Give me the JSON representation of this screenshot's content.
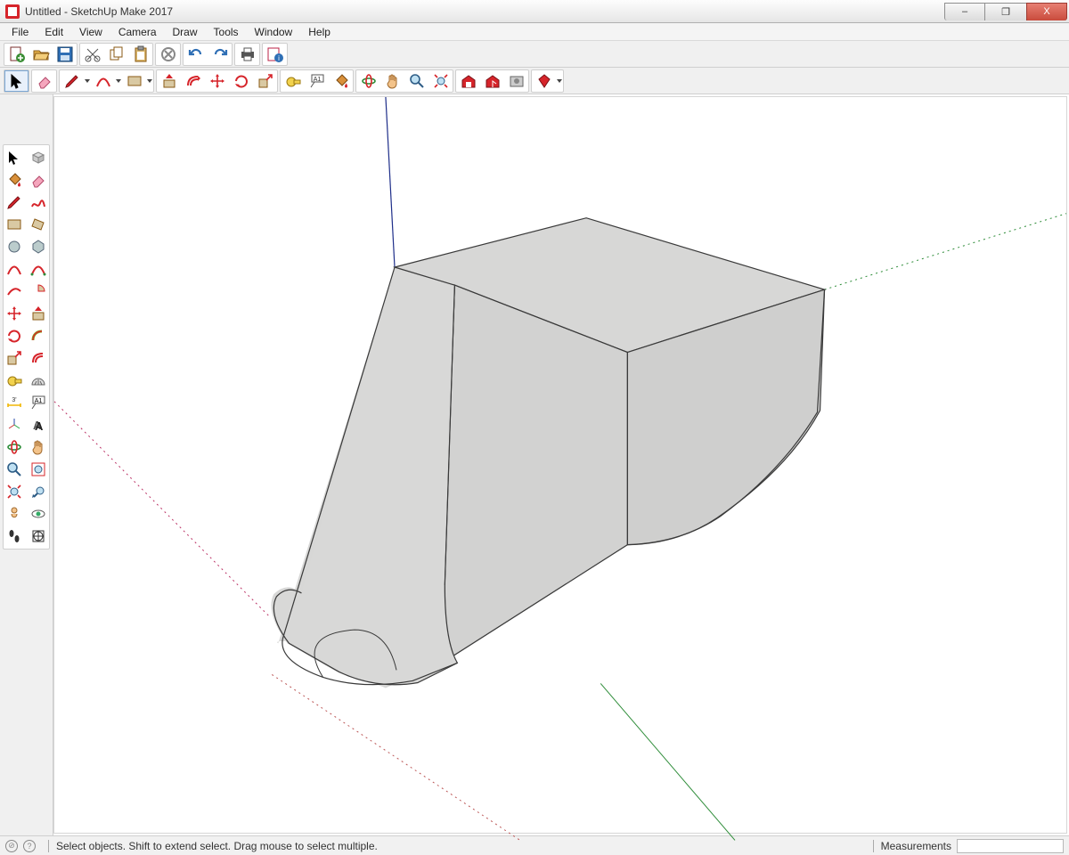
{
  "window": {
    "title": "Untitled - SketchUp Make 2017"
  },
  "menu": {
    "items": [
      "File",
      "Edit",
      "View",
      "Camera",
      "Draw",
      "Tools",
      "Window",
      "Help"
    ]
  },
  "toolbar1": {
    "new": "new-file",
    "open": "open-file",
    "save": "save-file",
    "cut": "cut",
    "copy": "copy",
    "paste": "paste",
    "erase": "delete",
    "undo": "undo",
    "redo": "redo",
    "print": "print",
    "model-info": "model-info"
  },
  "toolbar2": {
    "select": "select",
    "eraser": "eraser",
    "line": "line",
    "arc": "arc",
    "shape": "rectangle",
    "pushpull": "push-pull",
    "offset": "offset",
    "move": "move",
    "rotate": "rotate",
    "scale": "scale",
    "tape": "tape-measure",
    "text": "text",
    "paint": "paint-bucket",
    "orbit": "orbit",
    "pan": "pan",
    "zoom": "zoom",
    "zoom-ext": "zoom-extents",
    "warehouse": "3d-warehouse",
    "share": "share-model",
    "ext": "extensions",
    "ext-mgr": "ext-warehouse",
    "ruby": "ruby-console"
  },
  "palette": {
    "items": [
      "select",
      "make-component",
      "paint-bucket",
      "eraser",
      "line",
      "freehand",
      "rectangle",
      "rotated-rect",
      "circle",
      "polygon",
      "arc",
      "2pt-arc",
      "3pt-arc",
      "pie",
      "move",
      "push-pull",
      "rotate",
      "follow-me",
      "scale",
      "offset",
      "tape",
      "dimension",
      "protractor",
      "text",
      "axes",
      "3d-text",
      "orbit",
      "pan",
      "zoom",
      "zoom-window",
      "zoom-extents",
      "previous",
      "position-camera",
      "look-around",
      "walk",
      "section-plane"
    ]
  },
  "status": {
    "hint": "Select objects. Shift to extend select. Drag mouse to select multiple.",
    "measurements_label": "Measurements",
    "measurements_value": ""
  },
  "winbuttons": {
    "min": "–",
    "max": "❐",
    "close": "X"
  }
}
